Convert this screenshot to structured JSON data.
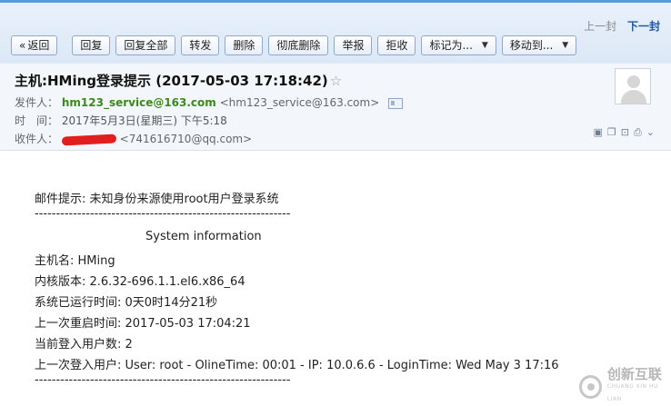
{
  "pager": {
    "prev": "上一封",
    "next": "下一封"
  },
  "toolbar": {
    "back": "返回",
    "reply": "回复",
    "reply_all": "回复全部",
    "forward": "转发",
    "delete": "删除",
    "delete_permanently": "彻底删除",
    "report": "举报",
    "reject": "拒收",
    "mark_as": "标记为...",
    "move_to": "移动到..."
  },
  "email": {
    "subject": "主机:HMing登录提示 (2017-05-03 17:18:42)",
    "sender_label": "发件人：",
    "sender_name": "hm123_service@163.com",
    "sender_address": "<hm123_service@163.com>",
    "time_label": "时　间：",
    "time_value": "2017年5月3日(星期三) 下午5:18",
    "recipient_label": "收件人：",
    "recipient_address": "<741616710@qq.com>"
  },
  "body": {
    "notice": "邮件提示: 未知身份来源使用root用户登录系统",
    "divider": "------------------------------------------------------------",
    "section_title": "System information",
    "hostname": "主机名: HMing",
    "kernel": "内核版本: 2.6.32-696.1.1.el6.x86_64",
    "uptime": "系统已运行时间: 0天0时14分21秒",
    "last_reboot": "上一次重启时间: 2017-05-03 17:04:21",
    "logged_users": "当前登入用户数: 2",
    "last_login": "上一次登入用户: User: root - OlineTime: 00:01 - IP: 10.0.6.6 - LoginTime: Wed May 3 17:16",
    "divider2": "------------------------------------------------------------"
  },
  "watermark": {
    "brand": "创新互联",
    "sub": "CHUANG XIN HU LIAN"
  },
  "icons": [
    "back-icon",
    "star-icon",
    "contact-card-icon",
    "avatar-icon",
    "window-icon",
    "print-icon",
    "expand-icon"
  ]
}
